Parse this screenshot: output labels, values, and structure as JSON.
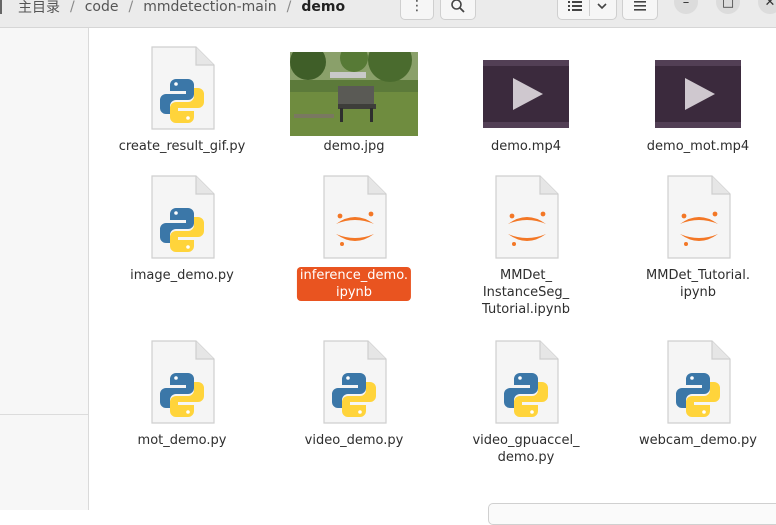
{
  "breadcrumb": {
    "items": [
      "主目录",
      "code",
      "mmdetection-main",
      "demo"
    ],
    "separator": "/"
  },
  "toolbar": {
    "menu_glyph": "⋮",
    "search_icon": "search-icon",
    "list_view_icon": "list-view-icon",
    "view_options_icon": "chevron-down-icon",
    "hamburger_icon": "hamburger-icon"
  },
  "window_controls": {
    "minimize": "–",
    "maximize": "□",
    "close": "✕"
  },
  "files": [
    {
      "name": "create_result_gif.py",
      "type": "python"
    },
    {
      "name": "demo.jpg",
      "type": "image"
    },
    {
      "name": "demo.mp4",
      "type": "video"
    },
    {
      "name": "demo_mot.mp4",
      "type": "video"
    },
    {
      "name": "image_demo.py",
      "type": "python"
    },
    {
      "name_lines": [
        "inference_demo.",
        "ipynb"
      ],
      "type": "notebook",
      "selected": true
    },
    {
      "name_lines": [
        "MMDet_",
        "InstanceSeg_",
        "Tutorial.ipynb"
      ],
      "type": "notebook"
    },
    {
      "name_lines": [
        "MMDet_Tutorial.",
        "ipynb"
      ],
      "type": "notebook"
    },
    {
      "name": "mot_demo.py",
      "type": "python"
    },
    {
      "name": "video_demo.py",
      "type": "python"
    },
    {
      "name_lines": [
        "video_gpuaccel_",
        "demo.py"
      ],
      "type": "python"
    },
    {
      "name": "webcam_demo.py",
      "type": "python"
    }
  ],
  "colors": {
    "selection": "#e95420",
    "python_blue": "#3b77a8",
    "python_yellow": "#ffd43b",
    "jupyter_orange": "#f37726",
    "video_bg": "#3b2a3d"
  }
}
